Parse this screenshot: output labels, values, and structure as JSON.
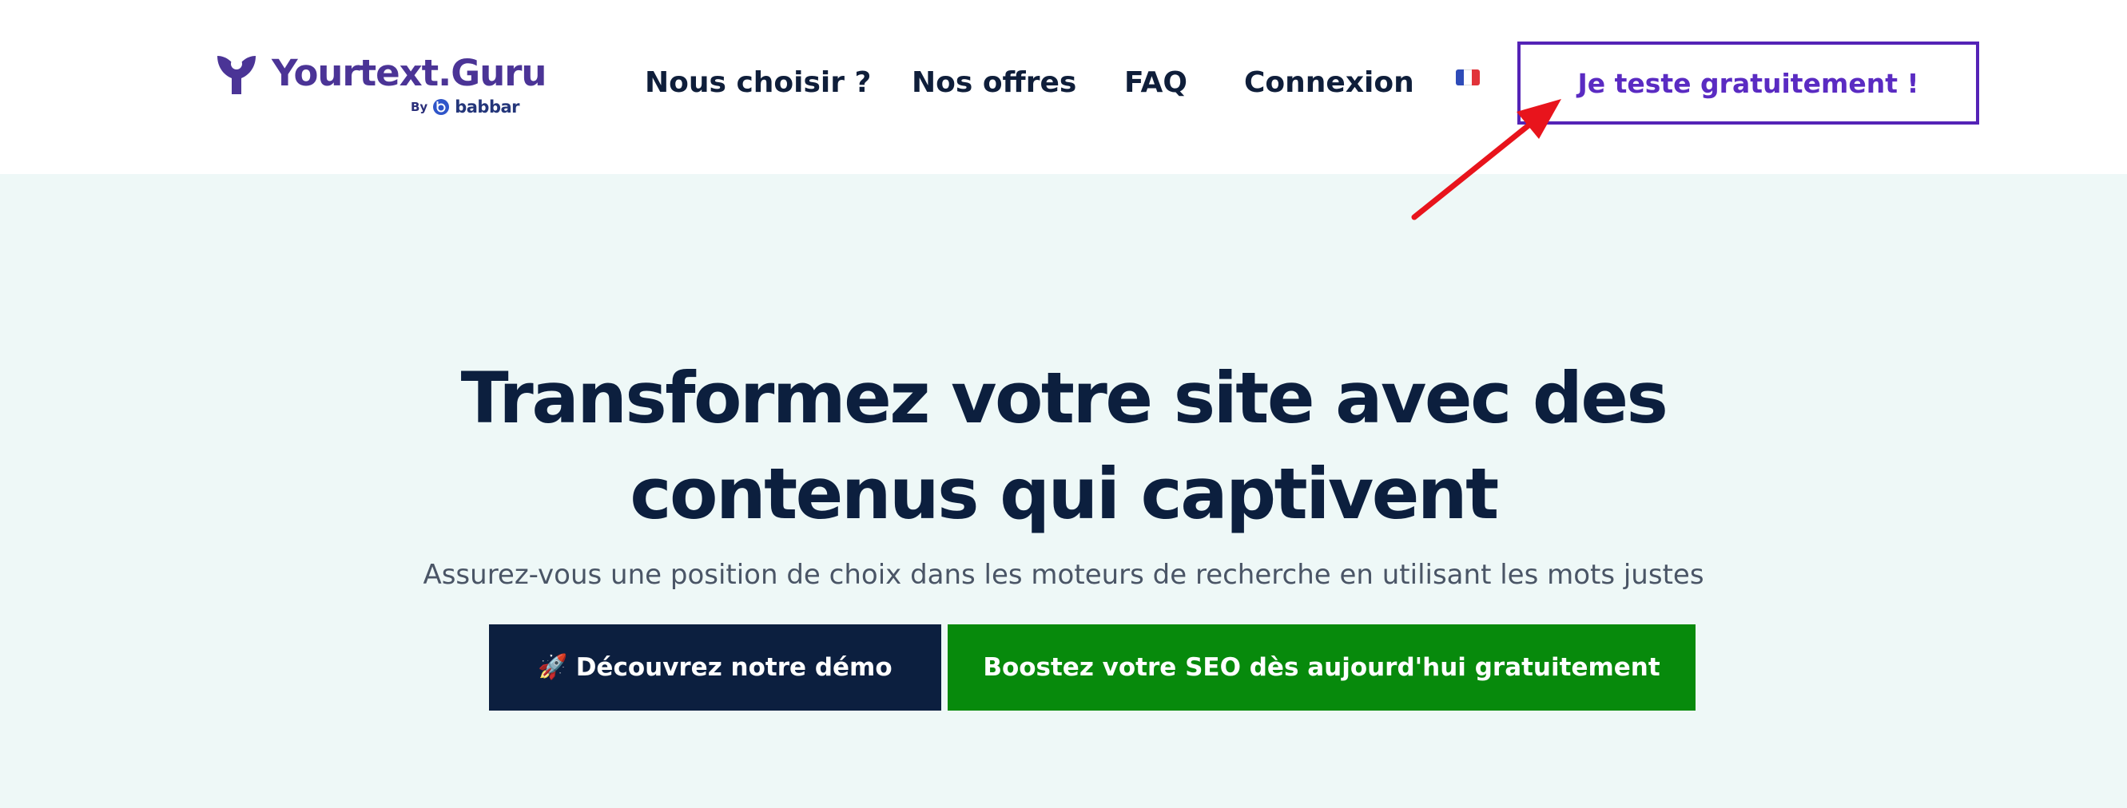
{
  "header": {
    "logo": {
      "text": "Yourtext.Guru",
      "by_label": "By",
      "by_brand": "babbar"
    },
    "nav": [
      {
        "label": "Nous choisir ?"
      },
      {
        "label": "Nos offres"
      },
      {
        "label": "FAQ"
      },
      {
        "label": "Connexion"
      }
    ],
    "language_flag": {
      "icon": "french-flag-icon",
      "colors": [
        "#2e4bb8",
        "#ffffff",
        "#e1333a"
      ]
    },
    "cta_label": "Je teste gratuitement !"
  },
  "hero": {
    "title_line1": "Transformez votre site avec des",
    "title_line2": "contenus qui captivent",
    "subtitle": "Assurez-vous une position de choix dans les moteurs de recherche en utilisant les mots justes",
    "buttons": {
      "demo": {
        "icon": "🚀",
        "label": "Découvrez notre démo"
      },
      "seo": {
        "label": "Boostez votre SEO dès aujourd'hui gratuitement"
      }
    }
  },
  "colors": {
    "brand_purple": "#4b3496",
    "cta_border": "#5423b6",
    "hero_background": "#eef8f7",
    "dark_navy": "#0c1f3f",
    "green": "#078a0c",
    "annotation_red": "#e8141c"
  }
}
